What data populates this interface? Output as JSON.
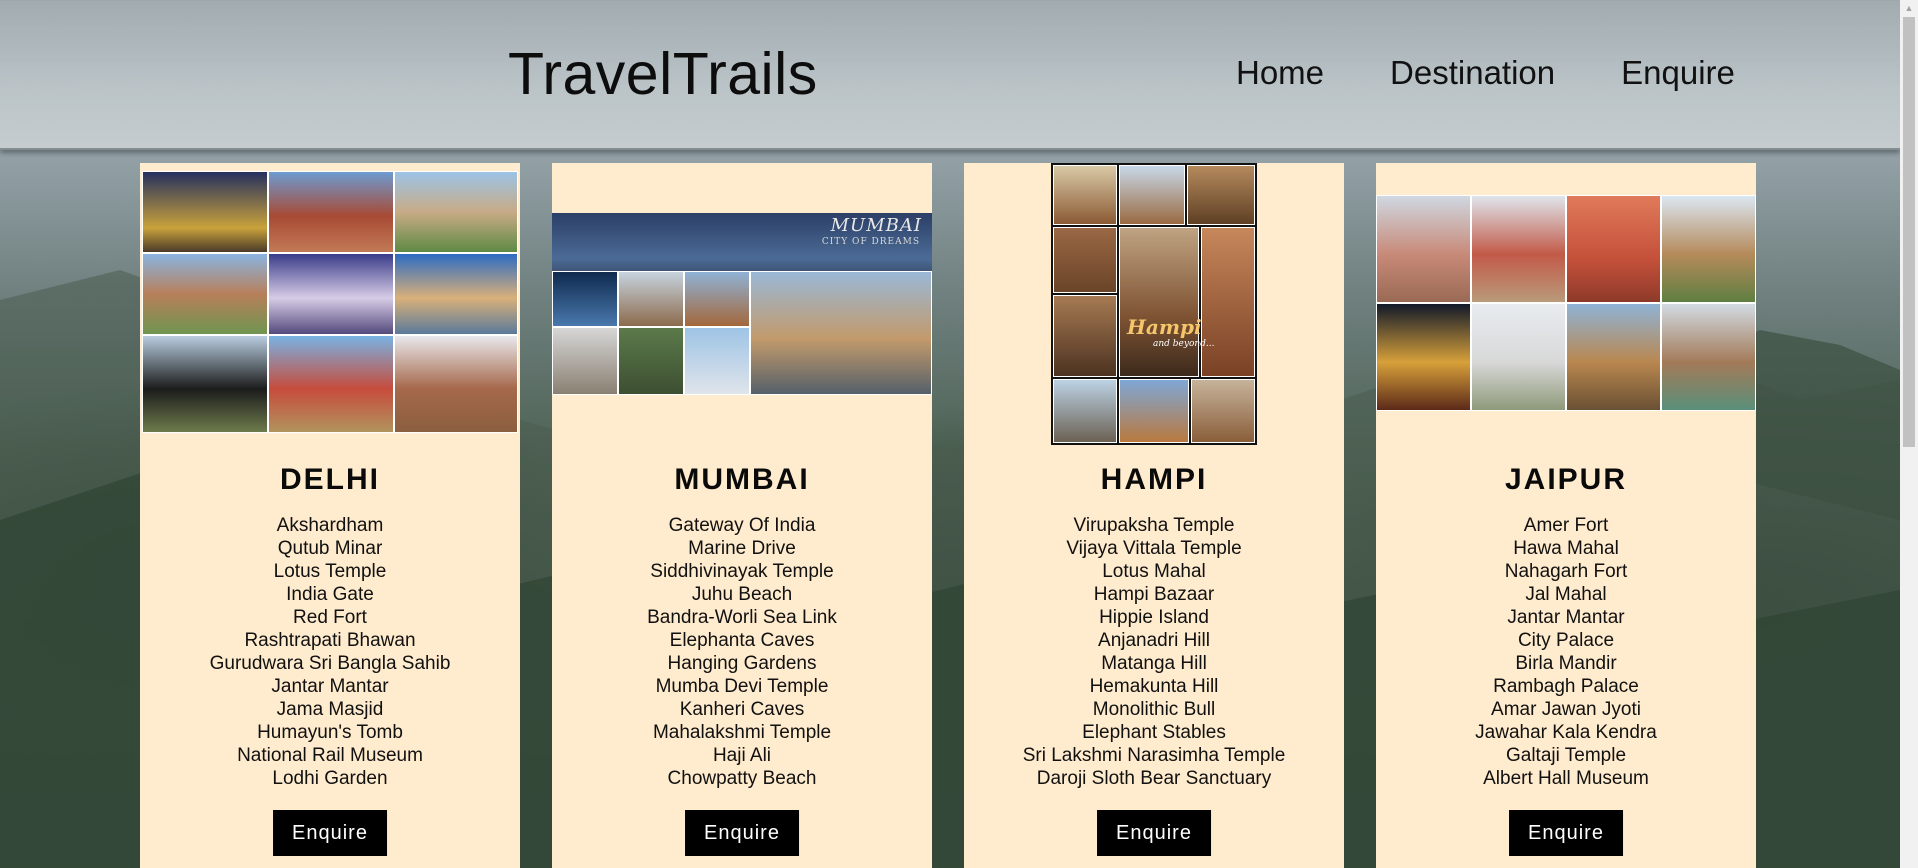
{
  "header": {
    "logo": "TravelTrails",
    "nav": [
      "Home",
      "Destination",
      "Enquire"
    ]
  },
  "cards": [
    {
      "city": "DELHI",
      "places": [
        "Akshardham",
        "Qutub Minar",
        "Lotus Temple",
        "India Gate",
        "Red Fort",
        "Rashtrapati Bhawan",
        "Gurudwara Sri Bangla Sahib",
        "Jantar Mantar",
        "Jama Masjid",
        "Humayun's Tomb",
        "National Rail Museum",
        "Lodhi Garden"
      ],
      "button": "Enquire"
    },
    {
      "city": "MUMBAI",
      "places": [
        "Gateway Of India",
        "Marine Drive",
        "Siddhivinayak Temple",
        "Juhu Beach",
        "Bandra-Worli Sea Link",
        "Elephanta Caves",
        "Hanging Gardens",
        "Mumba Devi Temple",
        "Kanheri Caves",
        "Mahalakshmi Temple",
        "Haji Ali",
        "Chowpatty Beach"
      ],
      "button": "Enquire",
      "image_text": {
        "title": "MUMBAI",
        "subtitle": "CITY OF DREAMS"
      }
    },
    {
      "city": "HAMPI",
      "places": [
        "Virupaksha Temple",
        "Vijaya Vittala Temple",
        "Lotus Mahal",
        "Hampi Bazaar",
        "Hippie Island",
        "Anjanadri Hill",
        "Matanga Hill",
        "Hemakunta Hill",
        "Monolithic Bull",
        "Elephant Stables",
        "Sri Lakshmi Narasimha Temple",
        "Daroji Sloth Bear Sanctuary"
      ],
      "button": "Enquire",
      "image_text": {
        "title": "Hampi",
        "subtitle": "and beyond..."
      }
    },
    {
      "city": "JAIPUR",
      "places": [
        "Amer Fort",
        "Hawa Mahal",
        "Nahagarh Fort",
        "Jal Mahal",
        "Jantar Mantar",
        "City Palace",
        "Birla Mandir",
        "Rambagh Palace",
        "Amar Jawan Jyoti",
        "Jawahar Kala Kendra",
        "Galtaji Temple",
        "Albert Hall Museum"
      ],
      "button": "Enquire"
    }
  ],
  "colors": {
    "card_background": "#ffebcd",
    "button_background": "#000000",
    "button_text": "#ffffff"
  }
}
